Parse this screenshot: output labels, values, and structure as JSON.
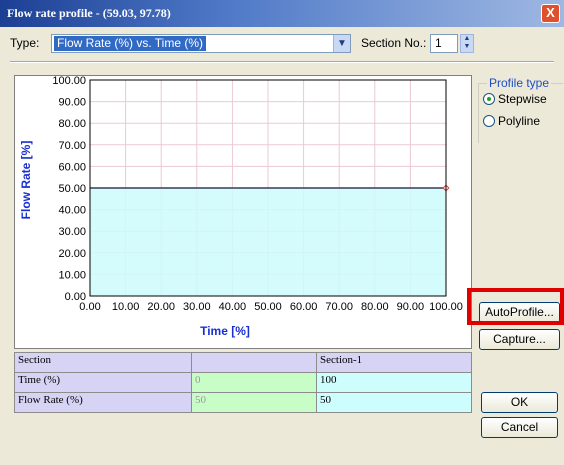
{
  "window": {
    "title": "Flow rate profile - (59.03, 97.78)",
    "close_glyph": "X"
  },
  "toolbar": {
    "type_label": "Type:",
    "type_value": "Flow Rate (%) vs. Time (%)",
    "section_label": "Section No.:",
    "section_value": "1"
  },
  "profile_type": {
    "title": "Profile type",
    "options": [
      {
        "label": "Stepwise",
        "selected": true
      },
      {
        "label": "Polyline",
        "selected": false
      }
    ]
  },
  "buttons": {
    "autoprofile": "AutoProfile...",
    "capture": "Capture...",
    "ok": "OK",
    "cancel": "Cancel"
  },
  "chart_data": {
    "type": "area",
    "xlabel": "Time [%]",
    "ylabel": "Flow Rate [%]",
    "xlim": [
      0,
      100
    ],
    "ylim": [
      0,
      100
    ],
    "x_ticks": [
      "0.00",
      "10.00",
      "20.00",
      "30.00",
      "40.00",
      "50.00",
      "60.00",
      "70.00",
      "80.00",
      "90.00",
      "100.00"
    ],
    "y_ticks": [
      "0.00",
      "10.00",
      "20.00",
      "30.00",
      "40.00",
      "50.00",
      "60.00",
      "70.00",
      "80.00",
      "90.00",
      "100.00"
    ],
    "grid": true,
    "series": [
      {
        "x": [
          0,
          100
        ],
        "y": [
          50,
          50
        ]
      }
    ],
    "fill_color": "#ccfcfc",
    "line_color": "#3a3a55",
    "grid_color": "#ebc9d4",
    "point_color": "#e83c3c"
  },
  "table": {
    "headers": [
      "Section",
      "",
      "Section-1"
    ],
    "rows": [
      {
        "label": "Time (%)",
        "values": [
          "0",
          "100"
        ]
      },
      {
        "label": "Flow Rate (%)",
        "values": [
          "50",
          "50"
        ]
      }
    ]
  },
  "colors": {
    "highlight": "#e00000",
    "title_bar": "#1c3f94",
    "group_title": "#1d4fc4"
  }
}
